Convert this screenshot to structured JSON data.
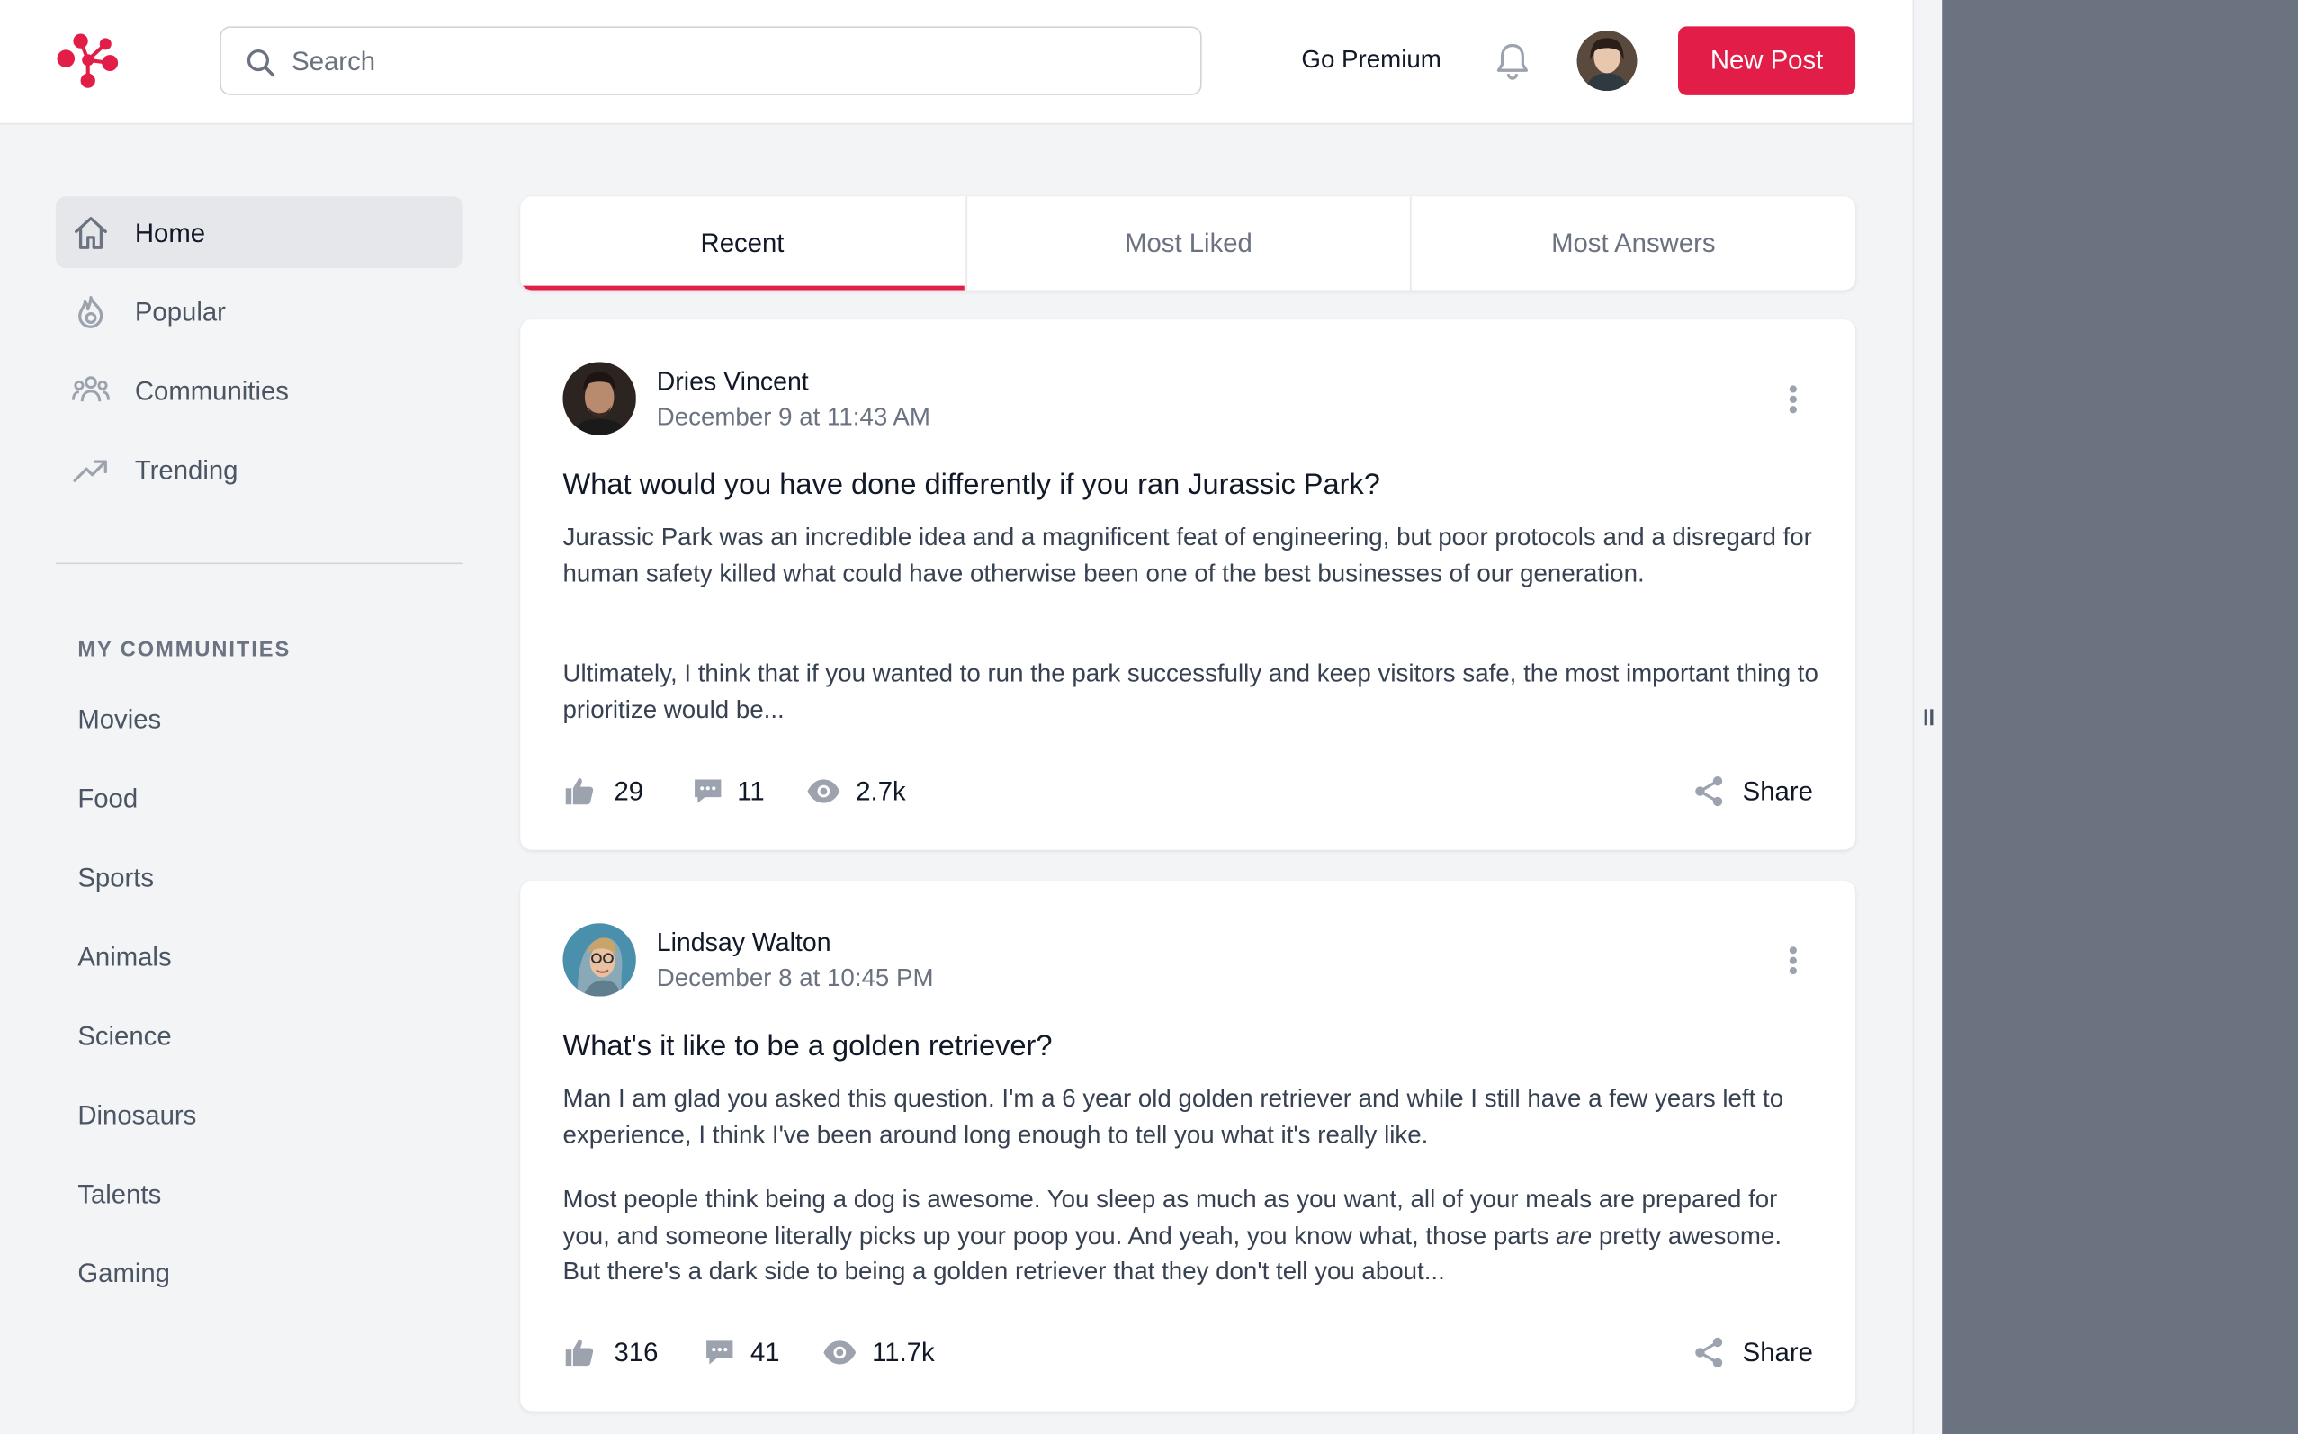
{
  "header": {
    "search_placeholder": "Search",
    "go_premium": "Go Premium",
    "new_post": "New Post"
  },
  "sidebar": {
    "nav": [
      {
        "label": "Home",
        "icon": "home-icon",
        "active": true
      },
      {
        "label": "Popular",
        "icon": "fire-icon",
        "active": false
      },
      {
        "label": "Communities",
        "icon": "user-group-icon",
        "active": false
      },
      {
        "label": "Trending",
        "icon": "trending-up-icon",
        "active": false
      }
    ],
    "section_title": "MY COMMUNITIES",
    "communities": [
      "Movies",
      "Food",
      "Sports",
      "Animals",
      "Science",
      "Dinosaurs",
      "Talents",
      "Gaming"
    ]
  },
  "tabs": [
    {
      "label": "Recent",
      "active": true
    },
    {
      "label": "Most Liked",
      "active": false
    },
    {
      "label": "Most Answers",
      "active": false
    }
  ],
  "posts": [
    {
      "author": "Dries Vincent",
      "date": "December 9 at 11:43 AM",
      "title": "What would you have done differently if you ran Jurassic Park?",
      "paragraphs": [
        "Jurassic Park was an incredible idea and a magnificent feat of engineering, but poor protocols and a disregard for human safety killed what could have otherwise been one of the best businesses of our generation.",
        "Ultimately, I think that if you wanted to run the park successfully and keep visitors safe, the most important thing to prioritize would be..."
      ],
      "likes": "29",
      "replies": "11",
      "views": "2.7k",
      "share": "Share"
    },
    {
      "author": "Lindsay Walton",
      "date": "December 8 at 10:45 PM",
      "title": "What's it like to be a golden retriever?",
      "paragraphs": [
        "Man I am glad you asked this question. I'm a 6 year old golden retriever and while I still have a few years left to experience, I think I've been around long enough to tell you what it's really like.",
        "Most people think being a dog is awesome. You sleep as much as you want, all of your meals are prepared for you, and someone literally picks up your poop you. And yeah, you know what, those parts",
        "are",
        " pretty awesome. But there's a dark side to being a golden retriever that they don't tell you about..."
      ],
      "likes": "316",
      "replies": "41",
      "views": "11.7k",
      "share": "Share"
    }
  ],
  "colors": {
    "accent": "#e11d48",
    "background": "#f3f4f6",
    "side_panel": "#6b7280"
  }
}
